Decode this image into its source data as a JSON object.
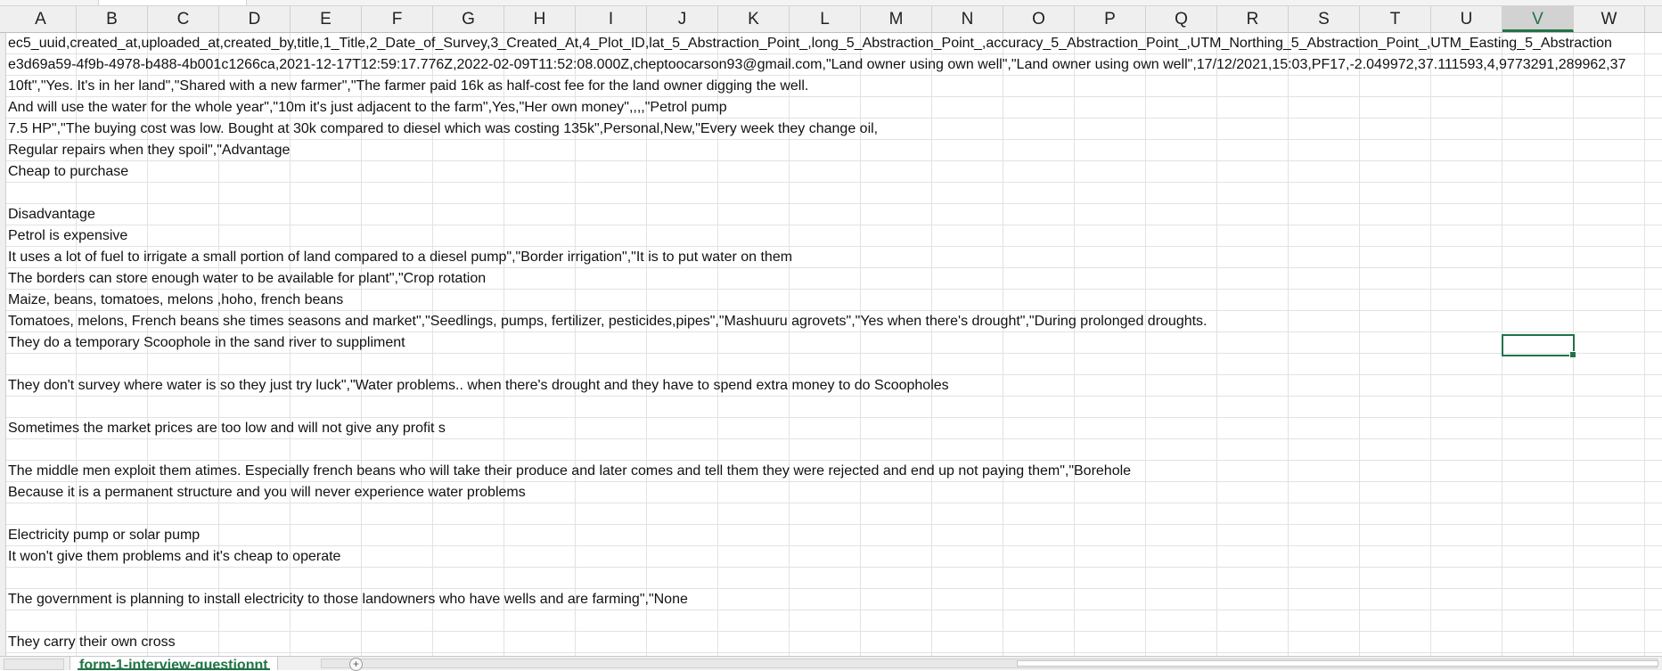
{
  "columns": [
    "A",
    "B",
    "C",
    "D",
    "E",
    "F",
    "G",
    "H",
    "I",
    "J",
    "K",
    "L",
    "M",
    "N",
    "O",
    "P",
    "Q",
    "R",
    "S",
    "T",
    "U",
    "V",
    "W"
  ],
  "selected_column": "V",
  "rows": [
    "ec5_uuid,created_at,uploaded_at,created_by,title,1_Title,2_Date_of_Survey,3_Created_At,4_Plot_ID,lat_5_Abstraction_Point_,long_5_Abstraction_Point_,accuracy_5_Abstraction_Point_,UTM_Northing_5_Abstraction_Point_,UTM_Easting_5_Abstraction",
    "e3d69a59-4f9b-4978-b488-4b001c1266ca,2021-12-17T12:59:17.776Z,2022-02-09T11:52:08.000Z,cheptoocarson93@gmail.com,\"Land owner using own well\",\"Land owner using own well\",17/12/2021,15:03,PF17,-2.049972,37.111593,4,9773291,289962,37",
    "10ft\",\"Yes. It's in her land\",\"Shared with a new farmer\",\"The farmer paid 16k as half-cost fee for the land owner digging the well.",
    "And will use the water for the whole year\",\"10m it's just adjacent to the farm\",Yes,\"Her own money\",,,,\"Petrol pump",
    "7.5 HP\",\"The buying cost was low. Bought at 30k compared to diesel which was costing 135k\",Personal,New,\"Every week they change oil,",
    "Regular repairs when they spoil\",\"Advantage",
    "Cheap to purchase",
    "",
    "Disadvantage",
    "Petrol is expensive",
    "It uses a lot of fuel to irrigate a small portion of land compared to a diesel pump\",\"Border irrigation\",\"It is to put water on them",
    "The borders can store enough water to be available for plant\",\"Crop rotation",
    "Maize, beans, tomatoes, melons ,hoho, french beans",
    "Tomatoes, melons, French beans she times seasons and market\",\"Seedlings, pumps, fertilizer, pesticides,pipes\",\"Mashuuru agrovets\",\"Yes when there's drought\",\"During prolonged droughts.",
    "They do a temporary Scoophole in the sand river to suppliment",
    "",
    "They don't survey where water is so they just try luck\",\"Water problems.. when there's drought and they have to spend extra money to do Scoopholes",
    "",
    "Sometimes the market prices are too low and will not give any profit s",
    "",
    "The middle men exploit them atimes. Especially french beans who will take their produce and later comes and tell them they were rejected and end up not paying them\",\"Borehole",
    "Because it is a permanent structure and you will never experience water problems",
    "",
    "Electricity pump or solar pump",
    "It won't give them problems and it's cheap to operate",
    "",
    "The government is planning to install electricity to those landowners who have wells and are farming\",\"None",
    "",
    "They carry their own cross"
  ],
  "sheet_tab_label": "form-1-interview-questionnt",
  "colors": {
    "accent": "#217346",
    "gridline": "#e2e2e2",
    "header_bg": "#efefef"
  }
}
